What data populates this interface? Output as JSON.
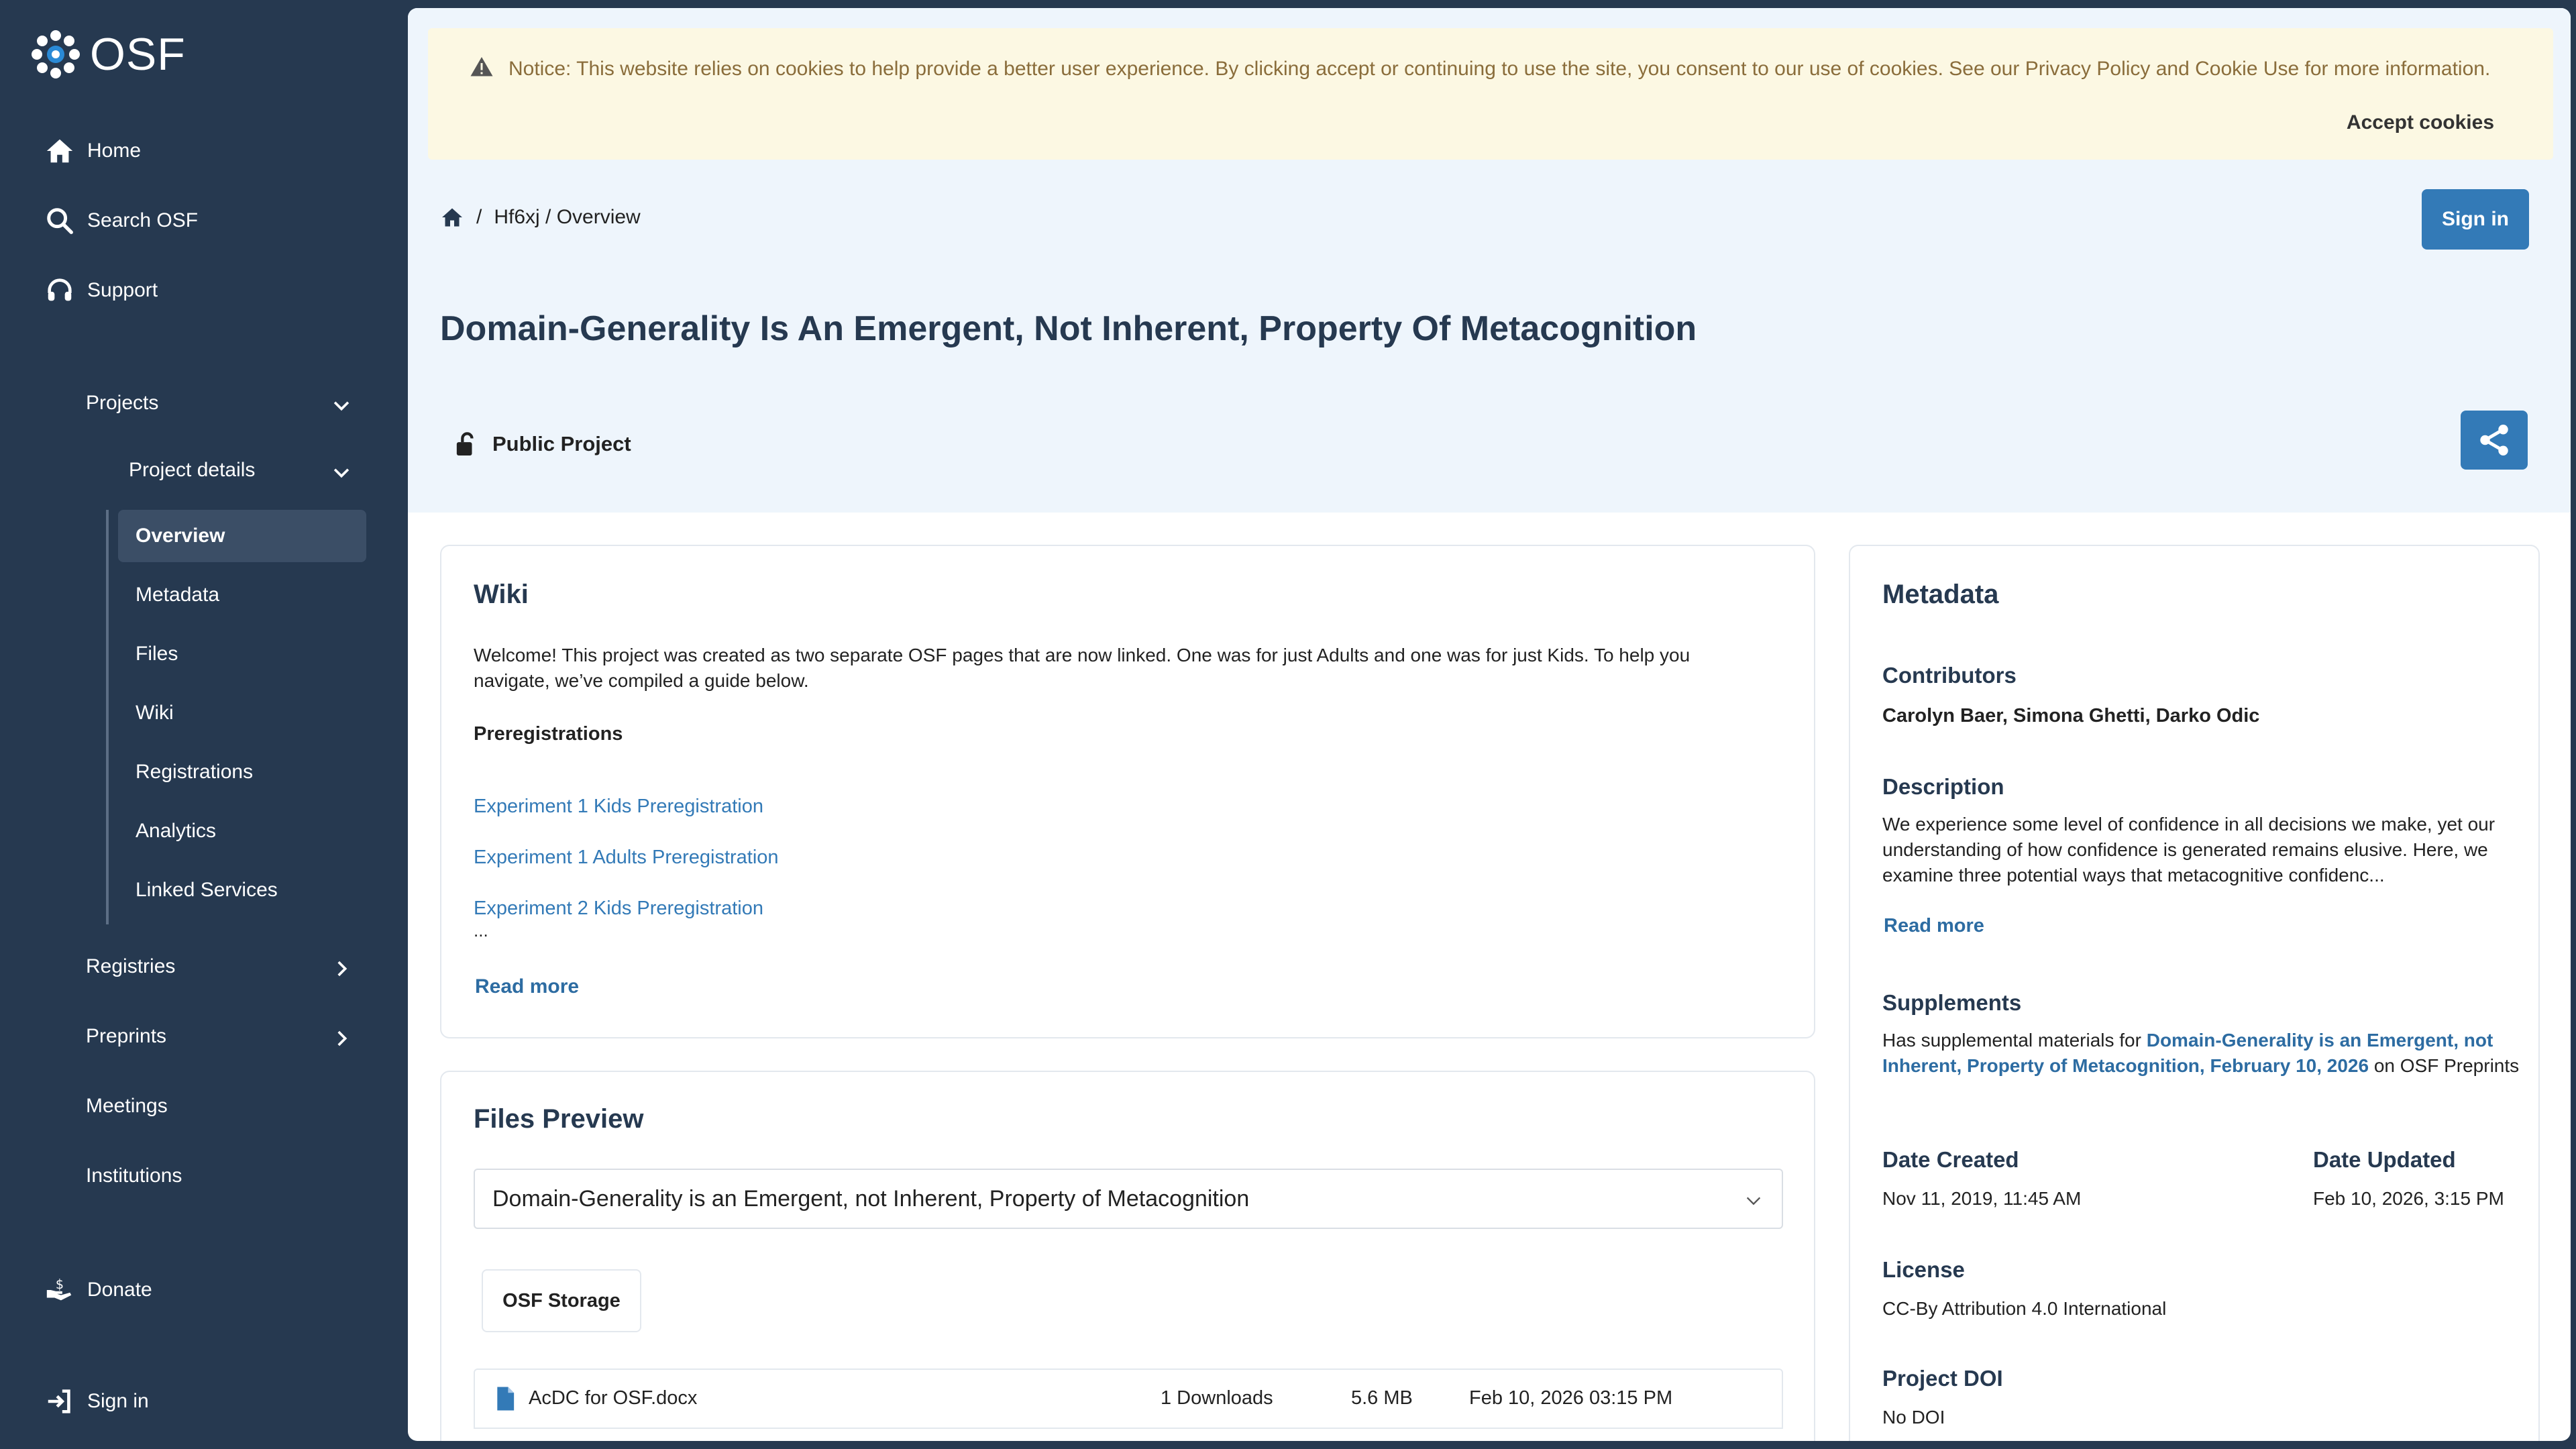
{
  "sidebar": {
    "logo_text": "OSF",
    "home": "Home",
    "search": "Search OSF",
    "support": "Support",
    "projects": "Projects",
    "project_details": "Project details",
    "subnav": [
      "Overview",
      "Metadata",
      "Files",
      "Wiki",
      "Registrations",
      "Analytics",
      "Linked Services"
    ],
    "registries": "Registries",
    "preprints": "Preprints",
    "meetings": "Meetings",
    "institutions": "Institutions",
    "donate": "Donate",
    "signin": "Sign in"
  },
  "cookie": {
    "notice": "Notice: This website relies on cookies to help provide a better user experience. By clicking accept or continuing to use the site, you consent to our use of cookies. See our Privacy Policy and Cookie Use for more information.",
    "accept": "Accept cookies"
  },
  "breadcrumb": {
    "sep": "/",
    "path": "Hf6xj / Overview"
  },
  "header": {
    "signin": "Sign in",
    "title": "Domain-Generality Is An Emergent, Not Inherent, Property Of Metacognition",
    "visibility": "Public Project"
  },
  "wiki": {
    "heading": "Wiki",
    "text": "Welcome! This project was created as two separate OSF pages that are now linked. One was for just Adults and one was for just Kids. To help you navigate, we’ve compiled a guide below.",
    "section": "Preregistrations",
    "links": [
      "Experiment 1 Kids Preregistration",
      "Experiment 1 Adults Preregistration",
      "Experiment 2 Kids Preregistration"
    ],
    "ellipsis": "...",
    "read_more": "Read more"
  },
  "files": {
    "heading": "Files Preview",
    "selected": "Domain-Generality is an Emergent, not Inherent, Property of Metacognition",
    "storage": "OSF Storage",
    "row": {
      "name": "AcDC for OSF.docx",
      "downloads": "1 Downloads",
      "size": "5.6 MB",
      "date": "Feb 10, 2026 03:15 PM"
    }
  },
  "metadata": {
    "heading": "Metadata",
    "contributors_label": "Contributors",
    "contributors": "Carolyn Baer, Simona Ghetti, Darko Odic",
    "description_label": "Description",
    "description": "We experience some level of confidence in all decisions we make, yet our understanding of how confidence is generated remains elusive. Here, we examine three potential ways that metacognitive confidenc...",
    "read_more": "Read more",
    "supplements_label": "Supplements",
    "supp_prefix": "Has supplemental materials for ",
    "supp_link": "Domain-Generality is an Emergent, not Inherent, Property of Metacognition, February 10, 2026",
    "supp_suffix": " on OSF Preprints",
    "date_created_label": "Date Created",
    "date_created": "Nov 11, 2019, 11:45 AM",
    "date_updated_label": "Date Updated",
    "date_updated": "Feb 10, 2026, 3:15 PM",
    "license_label": "License",
    "license": "CC-By Attribution 4.0 International",
    "doi_label": "Project DOI",
    "doi": "No DOI"
  }
}
